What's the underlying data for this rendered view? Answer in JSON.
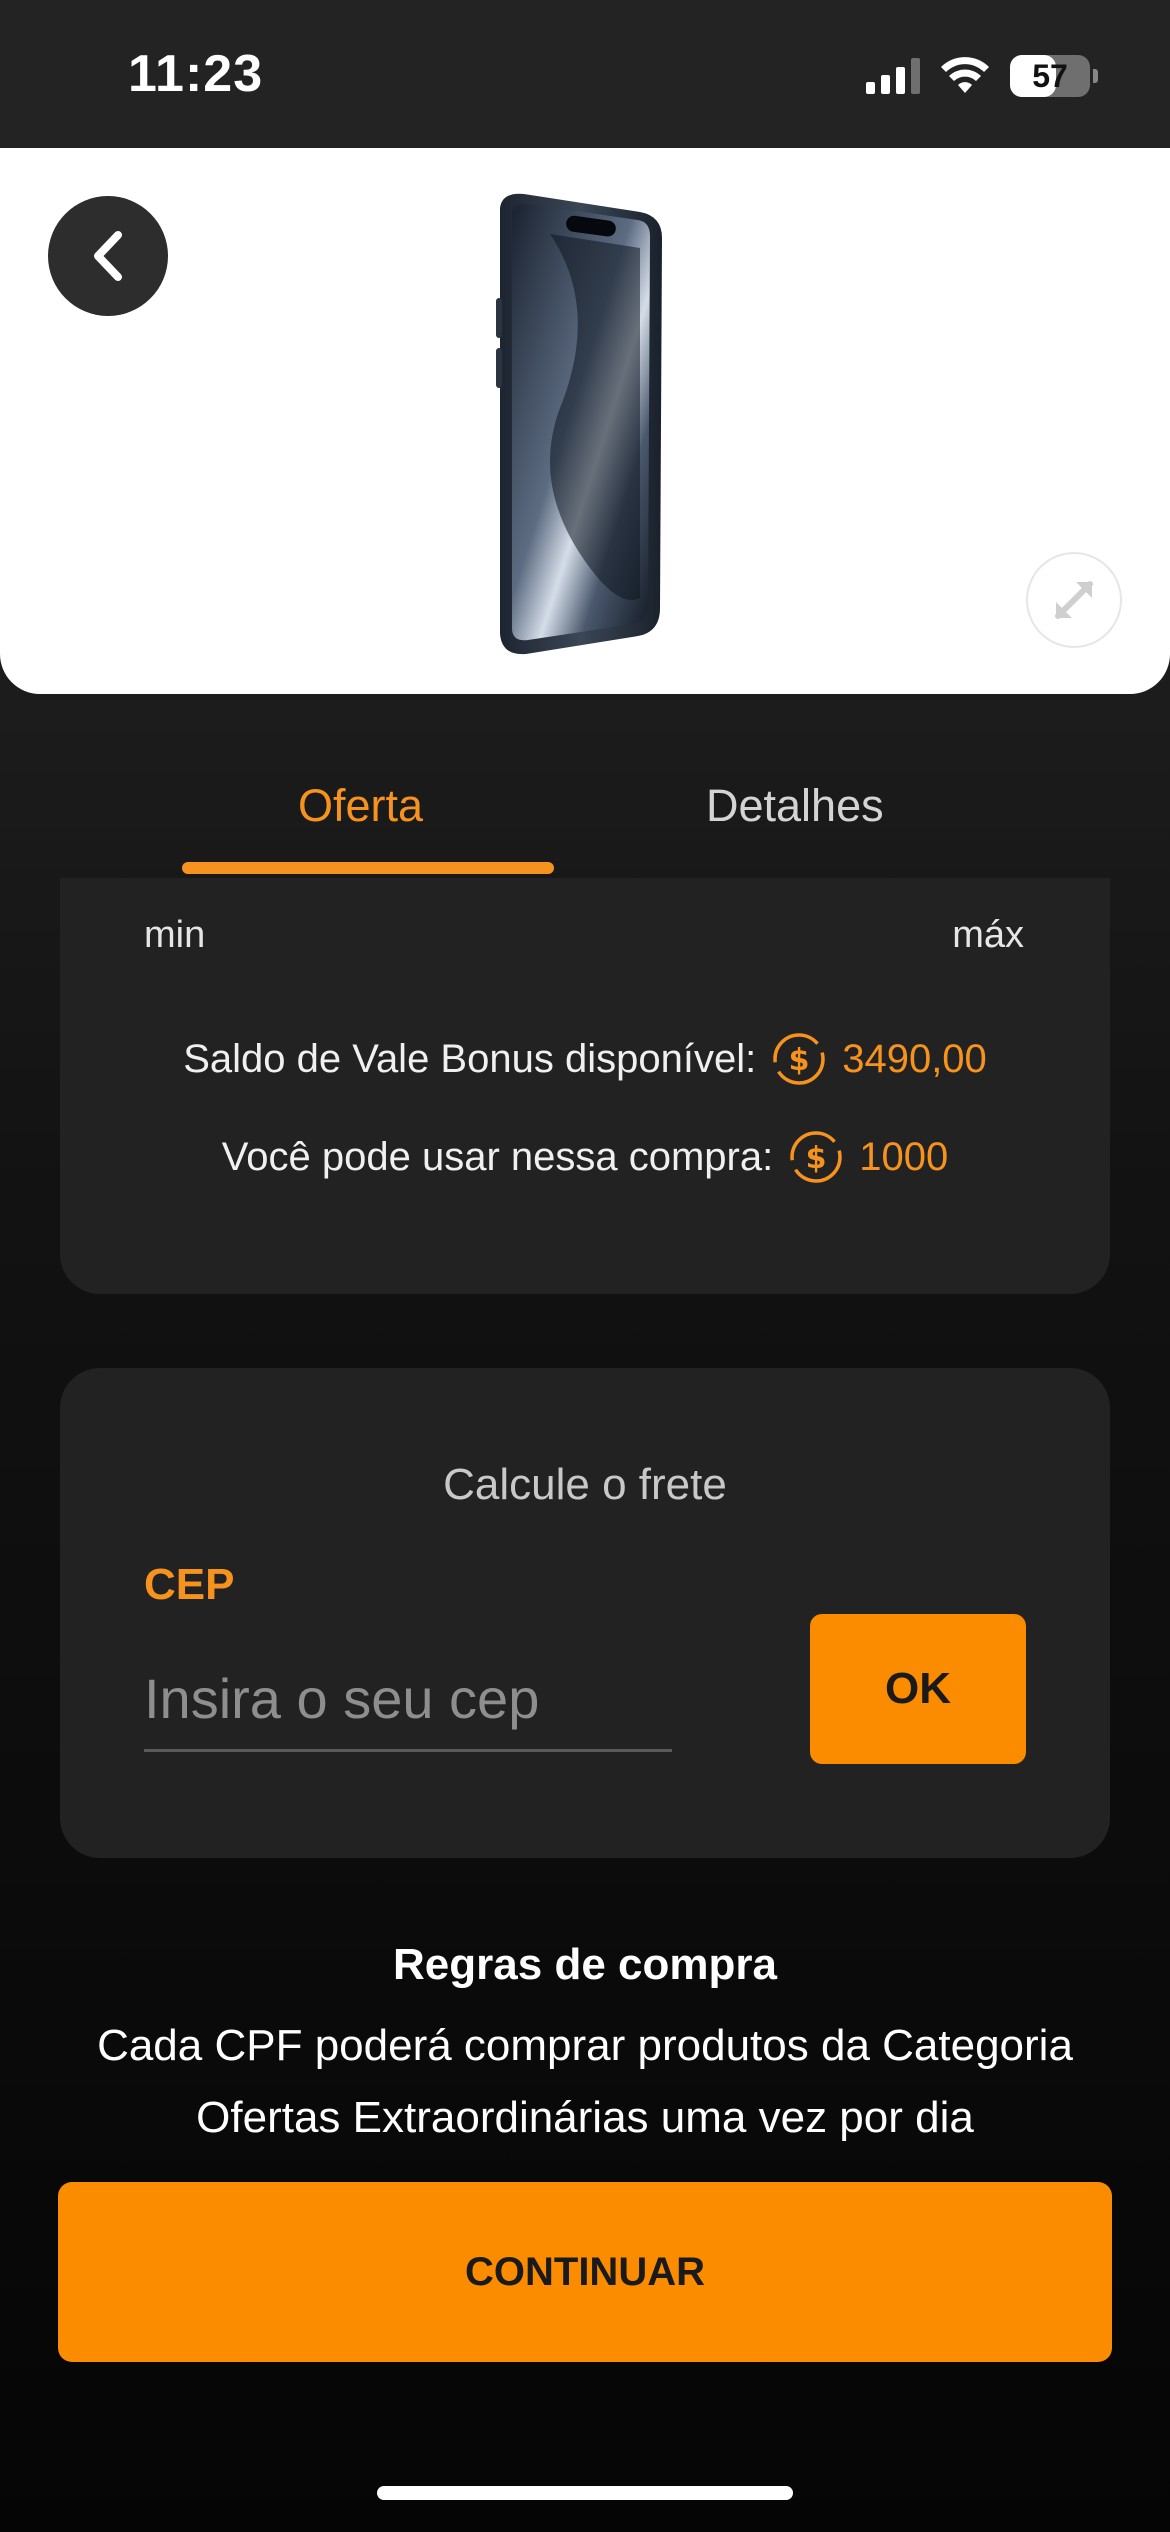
{
  "status_bar": {
    "time": "11:23",
    "battery": "57",
    "battery_level_pct": 57,
    "signal_icon": "cellular-signal-icon",
    "wifi_icon": "wifi-icon"
  },
  "product": {
    "image_icon": "smartphone-product-image",
    "back_icon": "chevron-left-icon",
    "expand_icon": "expand-arrows-icon"
  },
  "tabs": [
    {
      "label": "Oferta",
      "active": true
    },
    {
      "label": "Detalhes",
      "active": false
    }
  ],
  "bonus": {
    "min_label": "min",
    "max_label": "máx",
    "saldo_label": "Saldo de Vale Bonus disponível:",
    "saldo_value": "3490,00",
    "usar_label": "Você pode usar nessa compra:",
    "usar_value": "1000",
    "coin_icon": "bonus-coin-icon"
  },
  "shipping": {
    "title": "Calcule o frete",
    "cep_label": "CEP",
    "cep_placeholder": "Insira o seu cep",
    "cep_value": "",
    "ok_label": "OK"
  },
  "rules": {
    "title": "Regras de compra",
    "text": "Cada CPF poderá comprar produtos da Categoria Ofertas Extraordinárias uma vez por dia"
  },
  "continue_label": "CONTINUAR",
  "colors": {
    "accent": "#f6921e",
    "button": "#fb8c00",
    "card": "#222222",
    "background": "#1c1c1c"
  }
}
